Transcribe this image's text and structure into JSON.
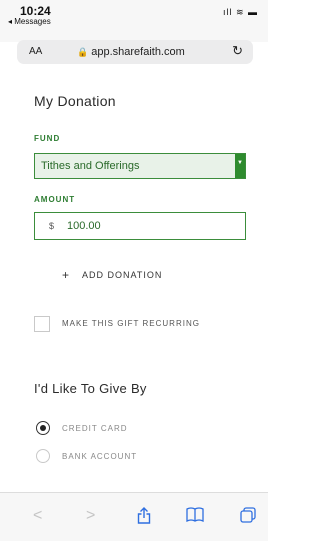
{
  "status_bar": {
    "time": "10:24",
    "back_app": "◂ Messages",
    "icons": "..ıl ᯤ ▬"
  },
  "browser": {
    "text_size": "AA",
    "url": "app.sharefaith.com",
    "reload": "↻"
  },
  "form": {
    "title": "My Donation",
    "fund_label": "FUND",
    "fund_value": "Tithes and Offerings",
    "amount_label": "AMOUNT",
    "currency": "$",
    "amount_value": "100.00",
    "add_donation": "ADD DONATION",
    "recurring_label": "MAKE THIS GIFT RECURRING"
  },
  "payment": {
    "title": "I'd Like To Give By",
    "options": [
      {
        "label": "CREDIT CARD",
        "selected": true
      },
      {
        "label": "BANK ACCOUNT",
        "selected": false
      }
    ]
  },
  "toolbar": {
    "items": [
      "back-icon",
      "forward-icon",
      "share-icon",
      "bookmarks-icon",
      "tabs-icon"
    ]
  }
}
